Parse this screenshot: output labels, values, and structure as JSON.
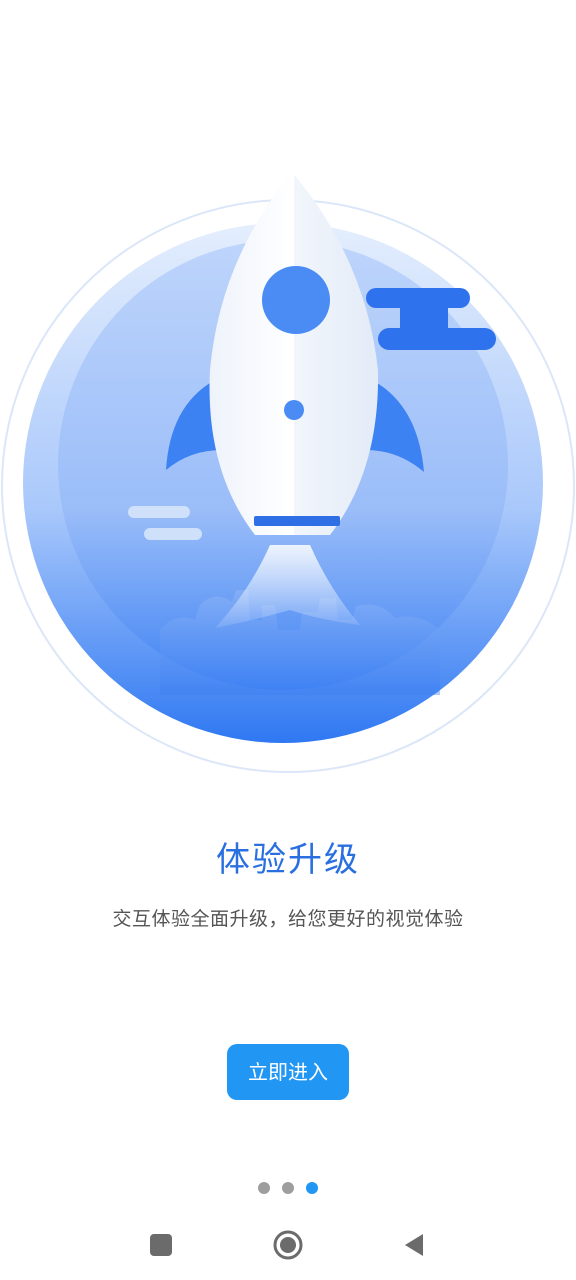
{
  "onboarding": {
    "title": "体验升级",
    "subtitle": "交互体验全面升级，给您更好的视觉体验",
    "enter_button": "立即进入",
    "page_count": 3,
    "active_page": 3
  },
  "navigation_bar": {
    "recents_icon": "square-icon",
    "home_icon": "circle-home-icon",
    "back_icon": "triangle-back-icon"
  },
  "colors": {
    "accent": "#2196f3",
    "title": "#2a6fe0",
    "subtitle": "#555555",
    "dot_inactive": "#9e9e9e",
    "nav_icon": "#6b6b6b"
  }
}
